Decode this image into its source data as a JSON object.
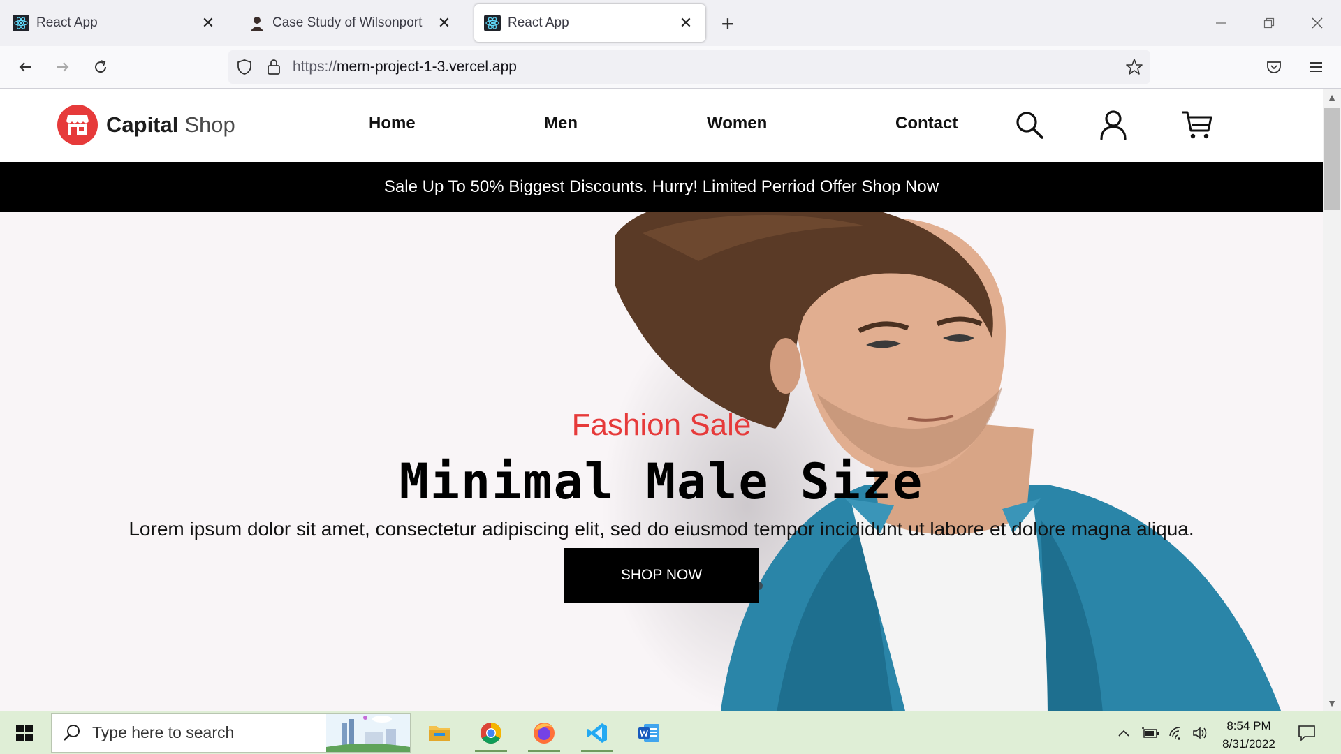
{
  "browser": {
    "tabs": [
      {
        "title": "React App",
        "favicon": "react-icon",
        "active": false
      },
      {
        "title": "Case Study of Wilsonport",
        "favicon": "person-icon",
        "active": false
      },
      {
        "title": "React App",
        "favicon": "react-icon",
        "active": true
      }
    ],
    "url_scheme": "https://",
    "url_host": "mern-project-1-3.vercel.app"
  },
  "site": {
    "logo": {
      "word1": "Capital",
      "word2": "Shop",
      "color": "#e63a3a"
    },
    "menu": [
      "Home",
      "Men",
      "Women",
      "Contact"
    ],
    "promo": "Sale Up To 50% Biggest Discounts. Hurry! Limited Perriod Offer Shop Now",
    "hero": {
      "subtitle": "Fashion Sale",
      "headline": "Minimal Male Size",
      "paragraph": "Lorem ipsum dolor sit amet, consectetur adipiscing elit, sed do eiusmod tempor incididunt ut labore et dolore magna aliqua.",
      "cta": "SHOP NOW"
    },
    "icons": [
      "search-icon",
      "user-icon",
      "cart-icon"
    ]
  },
  "taskbar": {
    "search_placeholder": "Type here to search",
    "time": "8:54 PM",
    "date": "8/31/2022",
    "apps": [
      "file-explorer-icon",
      "chrome-icon",
      "firefox-icon",
      "vscode-icon",
      "word-icon"
    ]
  }
}
